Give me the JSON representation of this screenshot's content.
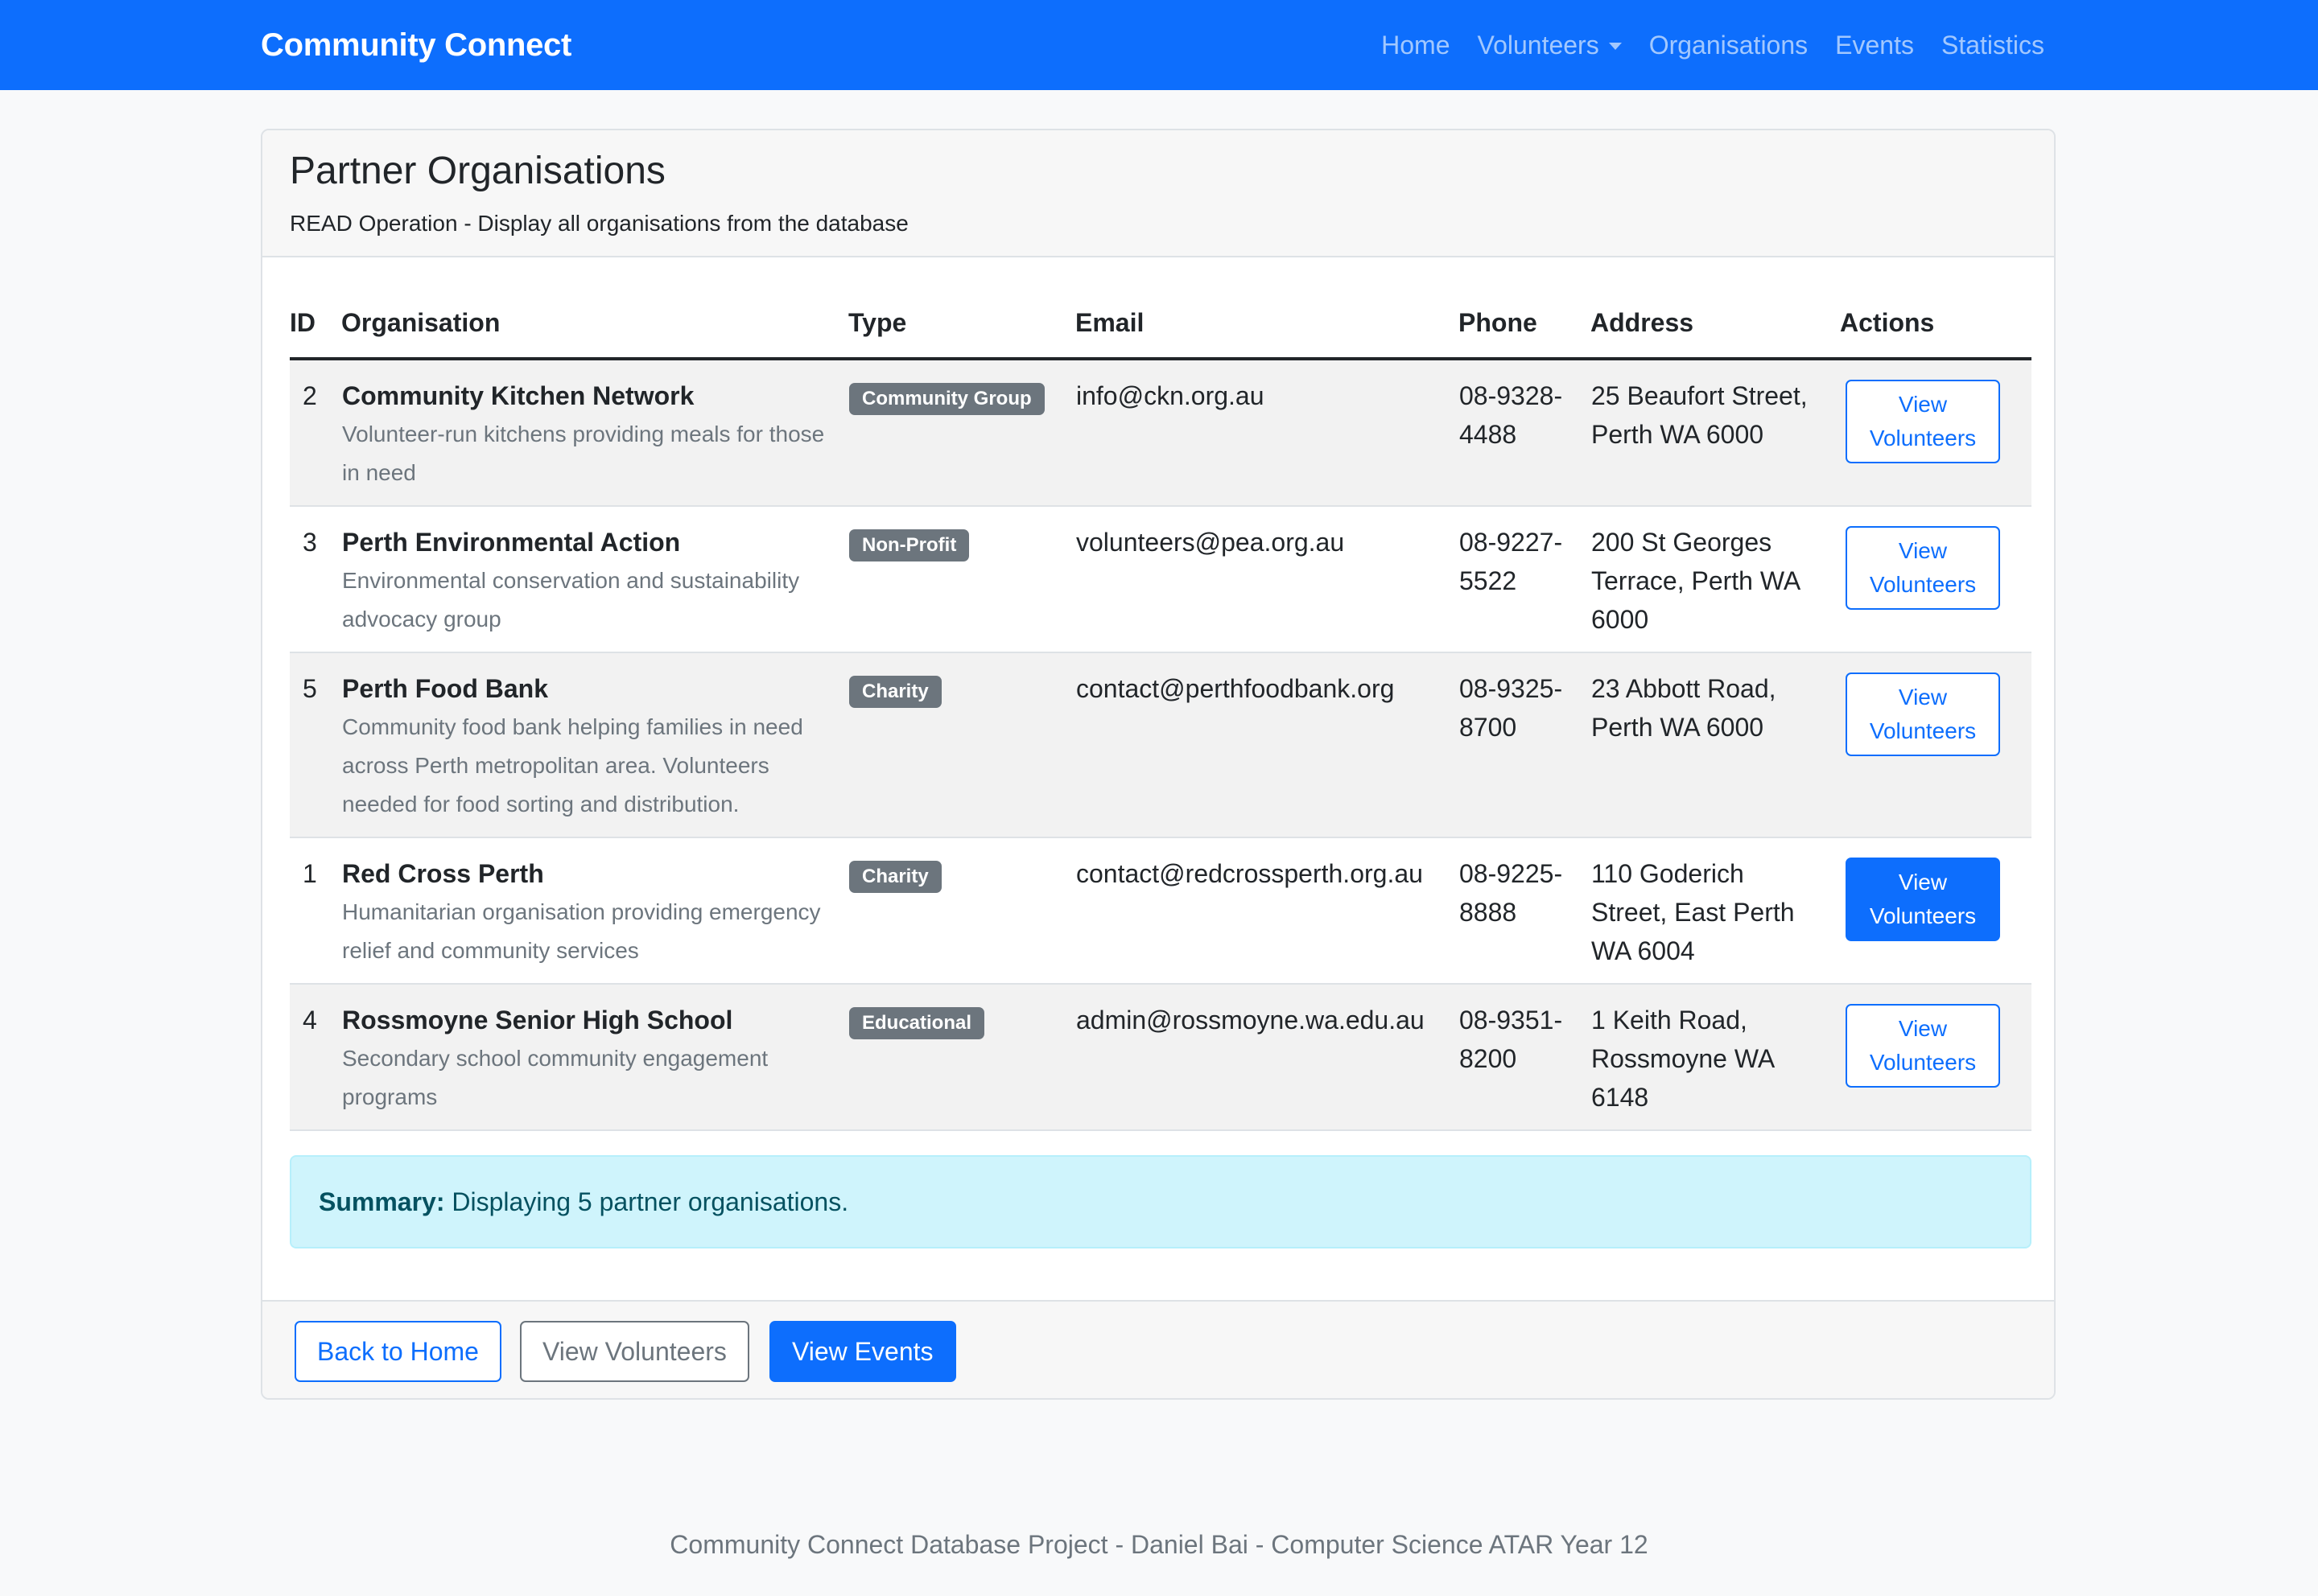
{
  "navbar": {
    "brand": "Community Connect",
    "links": [
      {
        "label": "Home"
      },
      {
        "label": "Volunteers"
      },
      {
        "label": "Organisations"
      },
      {
        "label": "Events"
      },
      {
        "label": "Statistics"
      }
    ]
  },
  "card": {
    "title": "Partner Organisations",
    "subtitle": "READ Operation - Display all organisations from the database"
  },
  "table": {
    "headers": [
      "ID",
      "Organisation",
      "Type",
      "Email",
      "Phone",
      "Address",
      "Actions"
    ],
    "action_label_line1": "View",
    "action_label_line2": "Volunteers",
    "rows": [
      {
        "id": "2",
        "name": "Community Kitchen Network",
        "description": "Volunteer-run kitchens providing meals for those in need",
        "type": "Community Group",
        "email": "info@ckn.org.au",
        "phone": "08-9328-4488",
        "address": "25 Beaufort Street, Perth WA 6000"
      },
      {
        "id": "3",
        "name": "Perth Environmental Action",
        "description": "Environmental conservation and sustainability advocacy group",
        "type": "Non-Profit",
        "email": "volunteers@pea.org.au",
        "phone": "08-9227-5522",
        "address": "200 St Georges Terrace, Perth WA 6000"
      },
      {
        "id": "5",
        "name": "Perth Food Bank",
        "description": "Community food bank helping families in need across Perth metropolitan area. Volunteers needed for food sorting and distribution.",
        "type": "Charity",
        "email": "contact@perthfoodbank.org",
        "phone": "08-9325-8700",
        "address": "23 Abbott Road, Perth WA 6000"
      },
      {
        "id": "1",
        "name": "Red Cross Perth",
        "description": "Humanitarian organisation providing emergency relief and community services",
        "type": "Charity",
        "email": "contact@redcrossperth.org.au",
        "phone": "08-9225-8888",
        "address": "110 Goderich Street, East Perth WA 6004"
      },
      {
        "id": "4",
        "name": "Rossmoyne Senior High School",
        "description": "Secondary school community engagement programs",
        "type": "Educational",
        "email": "admin@rossmoyne.wa.edu.au",
        "phone": "08-9351-8200",
        "address": "1 Keith Road, Rossmoyne WA 6148"
      }
    ]
  },
  "summary": {
    "label": "Summary:",
    "text": " Displaying 5 partner organisations."
  },
  "footer_buttons": {
    "back": "Back to Home",
    "volunteers": "View Volunteers",
    "events": "View Events"
  },
  "page_footer": "Community Connect Database Project - Daniel Bai - Computer Science ATAR Year 12",
  "colors": {
    "primary": "#0d6efd",
    "secondary": "#6c757d",
    "info_bg": "#cff4fc",
    "info_text": "#055160"
  }
}
